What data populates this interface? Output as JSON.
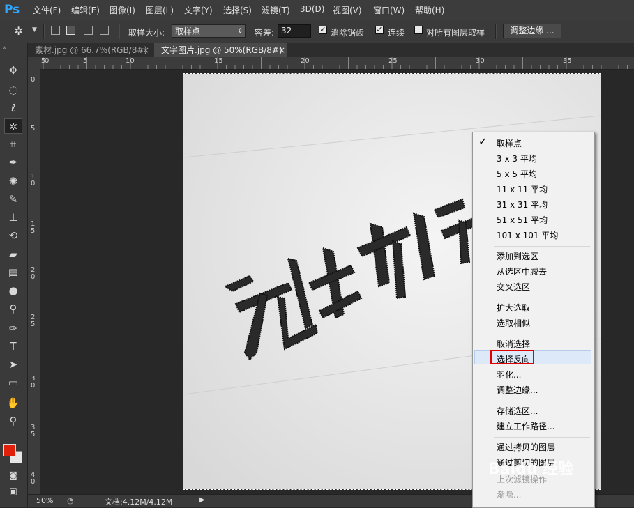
{
  "app": {
    "logo": "Ps"
  },
  "menubar": {
    "items": [
      "文件(F)",
      "编辑(E)",
      "图像(I)",
      "图层(L)",
      "文字(Y)",
      "选择(S)",
      "滤镜(T)",
      "3D(D)",
      "视图(V)",
      "窗口(W)",
      "帮助(H)"
    ]
  },
  "options": {
    "sample_size_label": "取样大小:",
    "sample_size_value": "取样点",
    "tolerance_label": "容差:",
    "tolerance_value": "32",
    "antialias_label": "消除锯齿",
    "contiguous_label": "连续",
    "all_layers_label": "对所有图层取样",
    "refine_edge_label": "调整边缘 ..."
  },
  "tabs": [
    {
      "label": "素材.jpg @ 66.7%(RGB/8#)",
      "close": "×"
    },
    {
      "label": "文字图片.jpg @ 50%(RGB/8#)",
      "close": "×"
    }
  ],
  "ruler_h": [
    "5",
    "0",
    "5",
    "10",
    "15",
    "20",
    "25",
    "30",
    "35"
  ],
  "ruler_v": [
    "0",
    "5",
    "1\n0",
    "1\n5",
    "2\n0",
    "2\n5",
    "3\n0",
    "3\n5",
    "4\n0"
  ],
  "status": {
    "zoom": "50%",
    "doc": "文档:4.12M/4.12M"
  },
  "context_menu": {
    "checked_item": "取样点",
    "groups": [
      [
        "取样点",
        "3 x 3 平均",
        "5 x 5 平均",
        "11 x 11 平均",
        "31 x 31 平均",
        "51 x 51 平均",
        "101 x 101 平均"
      ],
      [
        "添加到选区",
        "从选区中减去",
        "交叉选区"
      ],
      [
        "扩大选取",
        "选取相似"
      ],
      [
        "取消选择",
        "选择反向",
        "羽化...",
        "调整边缘..."
      ],
      [
        "存储选区...",
        "建立工作路径..."
      ],
      [
        "通过拷贝的图层",
        "通过剪切的图层",
        "上次滤镜操作",
        "渐隐..."
      ]
    ],
    "highlighted_item": "选择反向"
  },
  "watermark": "Baidu 经验",
  "colors": {
    "foreground": "#e0200a",
    "background": "#e6e6e6",
    "highlight_box": "#e00000"
  }
}
